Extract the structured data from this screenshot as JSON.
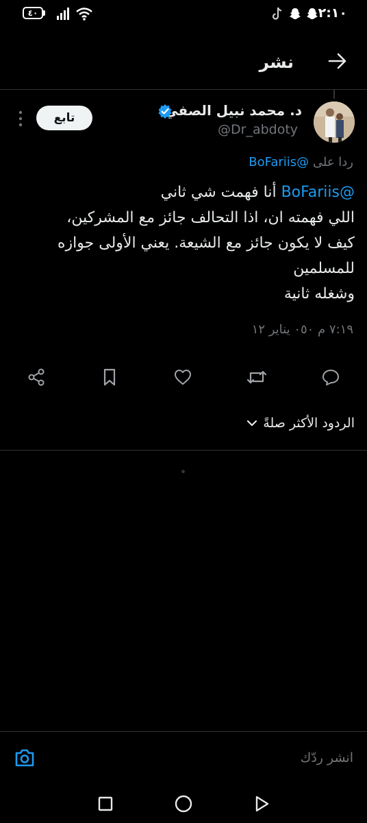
{
  "status_bar": {
    "time": "٢:١٠",
    "battery": "٤٠"
  },
  "header": {
    "title": "نشر"
  },
  "tweet": {
    "author_name": "د. محمد نبيل الصفي",
    "handle": "@Dr_abdoty",
    "follow_label": "تابع",
    "reply_to_prefix": "ردا على",
    "reply_to_mention": "@BoFariis",
    "text_mention": "@BoFariis",
    "text_line1": "أنا فهمت شي ثاني",
    "text_line2": "اللي فهمته ان، اذا التحالف جائز مع المشركين،",
    "text_line3": "كيف لا يكون جائز مع الشيعة. يعني الأولى جوازه",
    "text_line4": "للمسلمين",
    "text_line5": "وشغله ثانية",
    "timestamp": "٧:١٩ م ٠٥٠ يناير ١٢"
  },
  "actions": [
    "reply-icon",
    "retweet-icon",
    "like-icon",
    "bookmark-icon",
    "share-icon"
  ],
  "sort": {
    "label": "الردود الأكثر صلةً"
  },
  "composer": {
    "placeholder": "انشر ردّك"
  },
  "colors": {
    "accent": "#1d9bf0",
    "background": "#000000",
    "secondary_text": "#71767b"
  }
}
